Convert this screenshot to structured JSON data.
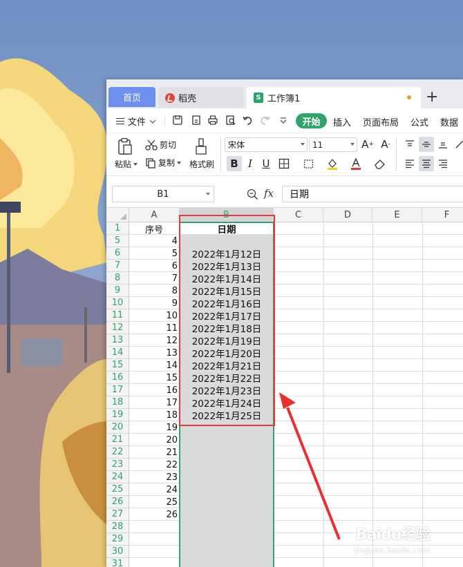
{
  "tabs": {
    "home": "首页",
    "daoke": "稻壳",
    "workbook": "工作簿1"
  },
  "menu": {
    "file": "文件",
    "active": "开始",
    "items": [
      "插入",
      "页面布局",
      "公式",
      "数据"
    ]
  },
  "ribbon": {
    "paste": "粘贴",
    "cut": "剪切",
    "copy": "复制",
    "format_painter": "格式刷",
    "font_name": "宋体",
    "font_size": "11",
    "bold": "B",
    "italic": "I",
    "underline": "U"
  },
  "formula_bar": {
    "name_box": "B1",
    "fx": "fx",
    "content": "日期"
  },
  "columns": [
    "A",
    "B",
    "C",
    "D",
    "E",
    "F"
  ],
  "rows": [
    {
      "num": "1",
      "a": "序号",
      "b": "日期"
    },
    {
      "num": "5",
      "a": "4",
      "b": ""
    },
    {
      "num": "6",
      "a": "5",
      "b": "2022年1月12日"
    },
    {
      "num": "7",
      "a": "6",
      "b": "2022年1月13日"
    },
    {
      "num": "8",
      "a": "7",
      "b": "2022年1月14日"
    },
    {
      "num": "9",
      "a": "8",
      "b": "2022年1月15日"
    },
    {
      "num": "10",
      "a": "9",
      "b": "2022年1月16日"
    },
    {
      "num": "11",
      "a": "10",
      "b": "2022年1月17日"
    },
    {
      "num": "12",
      "a": "11",
      "b": "2022年1月18日"
    },
    {
      "num": "13",
      "a": "12",
      "b": "2022年1月19日"
    },
    {
      "num": "14",
      "a": "13",
      "b": "2022年1月20日"
    },
    {
      "num": "15",
      "a": "14",
      "b": "2022年1月21日"
    },
    {
      "num": "16",
      "a": "15",
      "b": "2022年1月22日"
    },
    {
      "num": "17",
      "a": "16",
      "b": "2022年1月23日"
    },
    {
      "num": "18",
      "a": "17",
      "b": "2022年1月24日"
    },
    {
      "num": "19",
      "a": "18",
      "b": "2022年1月25日"
    },
    {
      "num": "20",
      "a": "19",
      "b": ""
    },
    {
      "num": "21",
      "a": "20",
      "b": ""
    },
    {
      "num": "22",
      "a": "21",
      "b": ""
    },
    {
      "num": "23",
      "a": "22",
      "b": ""
    },
    {
      "num": "24",
      "a": "23",
      "b": ""
    },
    {
      "num": "25",
      "a": "24",
      "b": ""
    },
    {
      "num": "26",
      "a": "25",
      "b": ""
    },
    {
      "num": "27",
      "a": "26",
      "b": ""
    },
    {
      "num": "28",
      "a": "",
      "b": ""
    },
    {
      "num": "29",
      "a": "",
      "b": ""
    },
    {
      "num": "30",
      "a": "",
      "b": ""
    },
    {
      "num": "31",
      "a": "",
      "b": ""
    }
  ],
  "watermark": {
    "main": "Baidu经验",
    "sub": "jingyan.baidu.com"
  },
  "colors": {
    "accent_green": "#2fa36b",
    "home_tab_blue": "#6d90ee",
    "annotation_red": "#e23a3a",
    "selected_column_gray": "#d9d9d9"
  }
}
